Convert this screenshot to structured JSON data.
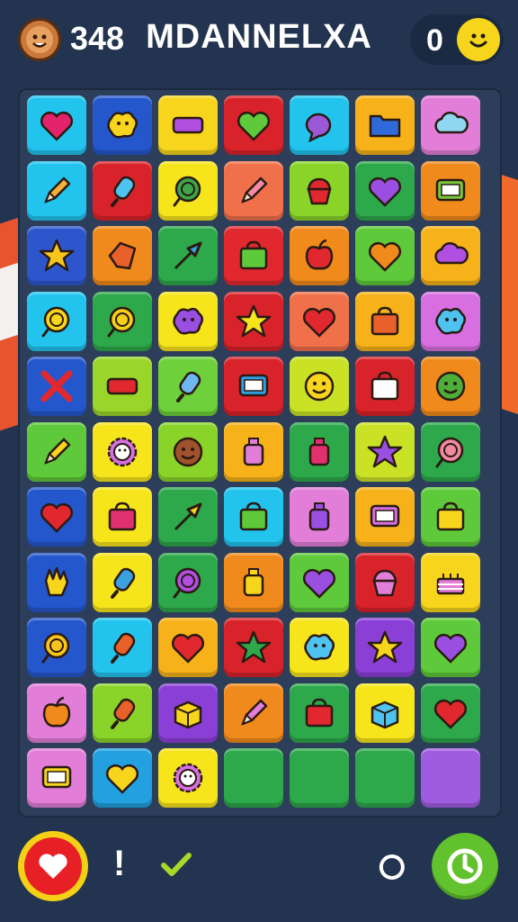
{
  "header": {
    "score": "348",
    "title": "MDANNELXA",
    "coins": "0",
    "avatar_icon": "face-avatar-icon",
    "smile_icon": "smiley-icon"
  },
  "footer": {
    "heart_icon": "heart-icon",
    "alert_glyph": "!",
    "check_icon": "check-icon",
    "refresh_icon": "refresh-icon",
    "timer_icon": "timer-icon"
  },
  "board": {
    "rows": [
      [
        {
          "c": "#22c4ee",
          "i": "heart",
          "k": "#e4246a"
        },
        {
          "c": "#2557cc",
          "i": "blob",
          "k": "#f7d51c"
        },
        {
          "c": "#f7d51c",
          "i": "bar",
          "k": "#b04fe0"
        },
        {
          "c": "#d8232a",
          "i": "heart",
          "k": "#5ec93a"
        },
        {
          "c": "#22c4ee",
          "i": "bubble",
          "k": "#9b59d6"
        },
        {
          "c": "#f7b21a",
          "i": "folder",
          "k": "#2e6ad9"
        },
        {
          "c": "#e27ed8",
          "i": "cloud",
          "k": "#8fd6f0"
        }
      ],
      [
        {
          "c": "#22c4ee",
          "i": "pencil",
          "k": "#f4b03c"
        },
        {
          "c": "#d8232a",
          "i": "popsicle",
          "k": "#4fc3f0"
        },
        {
          "c": "#f7e51c",
          "i": "lollipop",
          "k": "#3da54a"
        },
        {
          "c": "#f0704a",
          "i": "pencil",
          "k": "#f38aa3"
        },
        {
          "c": "#8ad42a",
          "i": "cupcake",
          "k": "#e0282e"
        },
        {
          "c": "#2da84a",
          "i": "heart",
          "k": "#9b4fe0"
        },
        {
          "c": "#f18a1c",
          "i": "frame",
          "k": "#7ac93a"
        }
      ],
      [
        {
          "c": "#2e56cc",
          "i": "star",
          "k": "#f7c51c"
        },
        {
          "c": "#f18a1c",
          "i": "tag",
          "k": "#e8602a"
        },
        {
          "c": "#2da84a",
          "i": "arrow",
          "k": "#3aa0e0"
        },
        {
          "c": "#e0282e",
          "i": "bag",
          "k": "#5ec93a"
        },
        {
          "c": "#f18a1c",
          "i": "apple",
          "k": "#e0282e"
        },
        {
          "c": "#5ec93a",
          "i": "heart",
          "k": "#f18a1c"
        },
        {
          "c": "#f7b21a",
          "i": "cloud",
          "k": "#b04fe0"
        }
      ],
      [
        {
          "c": "#22c4ee",
          "i": "lollipop",
          "k": "#f7d51c"
        },
        {
          "c": "#2da84a",
          "i": "lollipop",
          "k": "#f4d017"
        },
        {
          "c": "#f7e51c",
          "i": "blob",
          "k": "#9b4fe0"
        },
        {
          "c": "#d8232a",
          "i": "star",
          "k": "#f7e51c"
        },
        {
          "c": "#f0704a",
          "i": "heart",
          "k": "#e0282e"
        },
        {
          "c": "#f7b21a",
          "i": "bag",
          "k": "#e8602a"
        },
        {
          "c": "#d86fe0",
          "i": "blob",
          "k": "#4fc3f0"
        }
      ],
      [
        {
          "c": "#2557cc",
          "i": "cross",
          "k": "#e0282e"
        },
        {
          "c": "#9ad62a",
          "i": "bar",
          "k": "#e0282e"
        },
        {
          "c": "#6ed03a",
          "i": "popsicle",
          "k": "#6fb7f0"
        },
        {
          "c": "#d8232a",
          "i": "frame",
          "k": "#2ea0e0"
        },
        {
          "c": "#c9e226",
          "i": "smile",
          "k": "#f7d51c"
        },
        {
          "c": "#d8232a",
          "i": "bag",
          "k": "#ffffff"
        },
        {
          "c": "#f18a1c",
          "i": "smile",
          "k": "#4dae3a"
        }
      ],
      [
        {
          "c": "#5ec93a",
          "i": "pencil",
          "k": "#f7d51c"
        },
        {
          "c": "#f7e51c",
          "i": "flower",
          "k": "#d86fe0"
        },
        {
          "c": "#8ad42a",
          "i": "smile",
          "k": "#a0522d"
        },
        {
          "c": "#f7b21a",
          "i": "bottle",
          "k": "#e27ed8"
        },
        {
          "c": "#2da84a",
          "i": "bottle",
          "k": "#e0306e"
        },
        {
          "c": "#c9e226",
          "i": "star",
          "k": "#9b4fe0"
        },
        {
          "c": "#2da84a",
          "i": "lollipop",
          "k": "#f18aa0"
        }
      ],
      [
        {
          "c": "#2557cc",
          "i": "heart",
          "k": "#e0282e"
        },
        {
          "c": "#f7e51c",
          "i": "bag",
          "k": "#e0306e"
        },
        {
          "c": "#2da84a",
          "i": "arrow",
          "k": "#f7d51c"
        },
        {
          "c": "#22c4ee",
          "i": "bag",
          "k": "#5ec93a"
        },
        {
          "c": "#e27ed8",
          "i": "bottle",
          "k": "#9b4fe0"
        },
        {
          "c": "#f7b21a",
          "i": "frame",
          "k": "#d86fe0"
        },
        {
          "c": "#5ec93a",
          "i": "bag",
          "k": "#f7d51c"
        }
      ],
      [
        {
          "c": "#2557cc",
          "i": "hand",
          "k": "#f7d51c"
        },
        {
          "c": "#f7e51c",
          "i": "popsicle",
          "k": "#3aa0e0"
        },
        {
          "c": "#2da84a",
          "i": "lollipop",
          "k": "#b04fe0"
        },
        {
          "c": "#f18a1c",
          "i": "bottle",
          "k": "#f7d51c"
        },
        {
          "c": "#5ec93a",
          "i": "heart",
          "k": "#9b4fe0"
        },
        {
          "c": "#d8232a",
          "i": "cupcake",
          "k": "#e27ed8"
        },
        {
          "c": "#f7d51c",
          "i": "cake",
          "k": "#e27ed8"
        }
      ],
      [
        {
          "c": "#2557cc",
          "i": "lollipop",
          "k": "#f7c51c"
        },
        {
          "c": "#22c4ee",
          "i": "popsicle",
          "k": "#e8602a"
        },
        {
          "c": "#f7b21a",
          "i": "heart",
          "k": "#e0282e"
        },
        {
          "c": "#d8232a",
          "i": "star",
          "k": "#2da84a"
        },
        {
          "c": "#f7e51c",
          "i": "blob",
          "k": "#4fc3f0"
        },
        {
          "c": "#8a3fd6",
          "i": "star",
          "k": "#f7d51c"
        },
        {
          "c": "#5ec93a",
          "i": "heart",
          "k": "#9b4fe0"
        }
      ],
      [
        {
          "c": "#e27ed8",
          "i": "apple",
          "k": "#f18a1c"
        },
        {
          "c": "#8ad42a",
          "i": "popsicle",
          "k": "#e8602a"
        },
        {
          "c": "#8a3fd6",
          "i": "box",
          "k": "#f7d51c"
        },
        {
          "c": "#f18a1c",
          "i": "pencil",
          "k": "#e27ed8"
        },
        {
          "c": "#2da84a",
          "i": "bag",
          "k": "#e0282e"
        },
        {
          "c": "#f7e51c",
          "i": "box",
          "k": "#4fc3f0"
        },
        {
          "c": "#2da84a",
          "i": "heart",
          "k": "#e0282e"
        }
      ],
      [
        {
          "c": "#e27ed8",
          "i": "frame",
          "k": "#f7d51c"
        },
        {
          "c": "#22a0e0",
          "i": "heart",
          "k": "#f7d51c"
        },
        {
          "c": "#f7e51c",
          "i": "flower",
          "k": "#d86fe0"
        },
        {
          "c": "#2da84a",
          "i": "none",
          "k": ""
        },
        {
          "c": "#2da84a",
          "i": "none",
          "k": ""
        },
        {
          "c": "#2da84a",
          "i": "none",
          "k": ""
        },
        {
          "c": "#a05ce0",
          "i": "none",
          "k": ""
        }
      ]
    ]
  }
}
